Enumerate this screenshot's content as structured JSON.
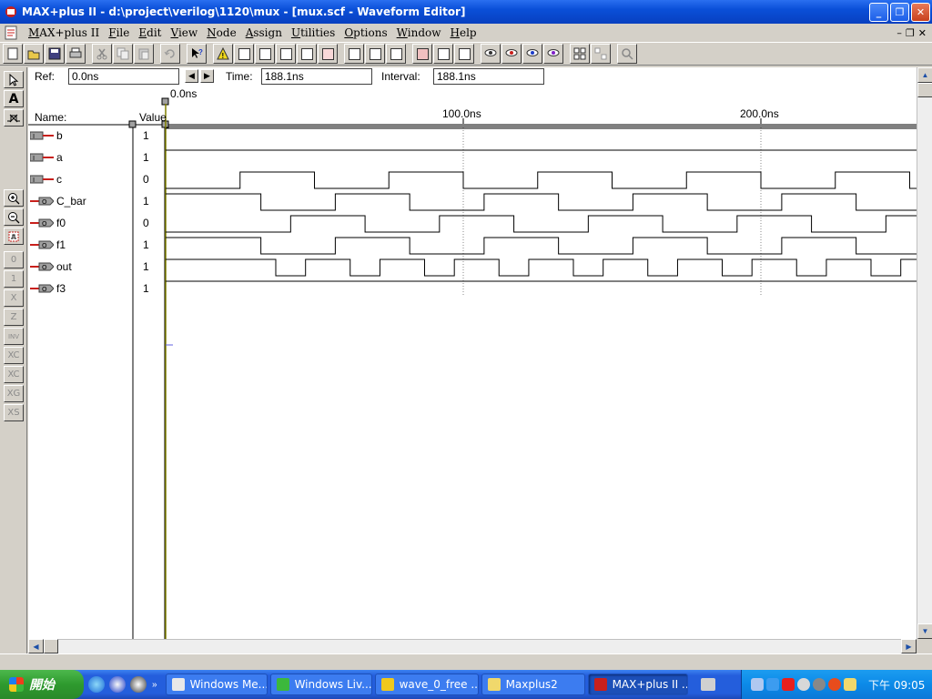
{
  "window": {
    "title": "MAX+plus II - d:\\project\\verilog\\1120\\mux - [mux.scf - Waveform Editor]"
  },
  "menu": {
    "items": [
      "MAX+plus II",
      "File",
      "Edit",
      "View",
      "Node",
      "Assign",
      "Utilities",
      "Options",
      "Window",
      "Help"
    ]
  },
  "refbar": {
    "ref_label": "Ref:",
    "ref_value": "0.0ns",
    "time_label": "Time:",
    "time_value": "188.1ns",
    "interval_label": "Interval:",
    "interval_value": "188.1ns"
  },
  "waveform": {
    "ref_marker_label": "0.0ns",
    "name_header": "Name:",
    "value_header": "Value",
    "ticks": [
      {
        "time_ns": 100,
        "label": "100.0ns"
      },
      {
        "time_ns": 200,
        "label": "200.0ns"
      }
    ],
    "ns_per_div": 100,
    "signals": [
      {
        "name": "b",
        "dir": "input",
        "value": "1",
        "levels": [
          1
        ],
        "toggle": null
      },
      {
        "name": "a",
        "dir": "input",
        "value": "1",
        "levels": [
          1
        ],
        "toggle": null
      },
      {
        "name": "c",
        "dir": "input",
        "value": "0",
        "toggle": {
          "initial": 0,
          "first_ns": 25,
          "period_half_ns": 25
        }
      },
      {
        "name": "C_bar",
        "dir": "output",
        "value": "1",
        "toggle": {
          "initial": 1,
          "first_ns": 32,
          "period_half_ns": 25
        }
      },
      {
        "name": "f0",
        "dir": "output",
        "value": "0",
        "toggle": {
          "initial": 0,
          "first_ns": 42,
          "period_half_ns": 25
        }
      },
      {
        "name": "f1",
        "dir": "output",
        "value": "1",
        "toggle": {
          "initial": 1,
          "first_ns": 32,
          "period_half_ns": 25
        }
      },
      {
        "name": "out",
        "dir": "output",
        "value": "1",
        "pulses": true
      },
      {
        "name": "f3",
        "dir": "output",
        "value": "1",
        "levels": [
          1
        ],
        "toggle": null
      }
    ]
  },
  "taskbar": {
    "start_label": "開始",
    "tasks": [
      {
        "label": "Windows Me...",
        "active": false
      },
      {
        "label": "Windows Liv...",
        "active": false
      },
      {
        "label": "wave_0_free ...",
        "active": false
      },
      {
        "label": "Maxplus2",
        "active": false
      },
      {
        "label": "MAX+plus II ...",
        "active": true
      }
    ],
    "clock": "下午 09:05"
  }
}
